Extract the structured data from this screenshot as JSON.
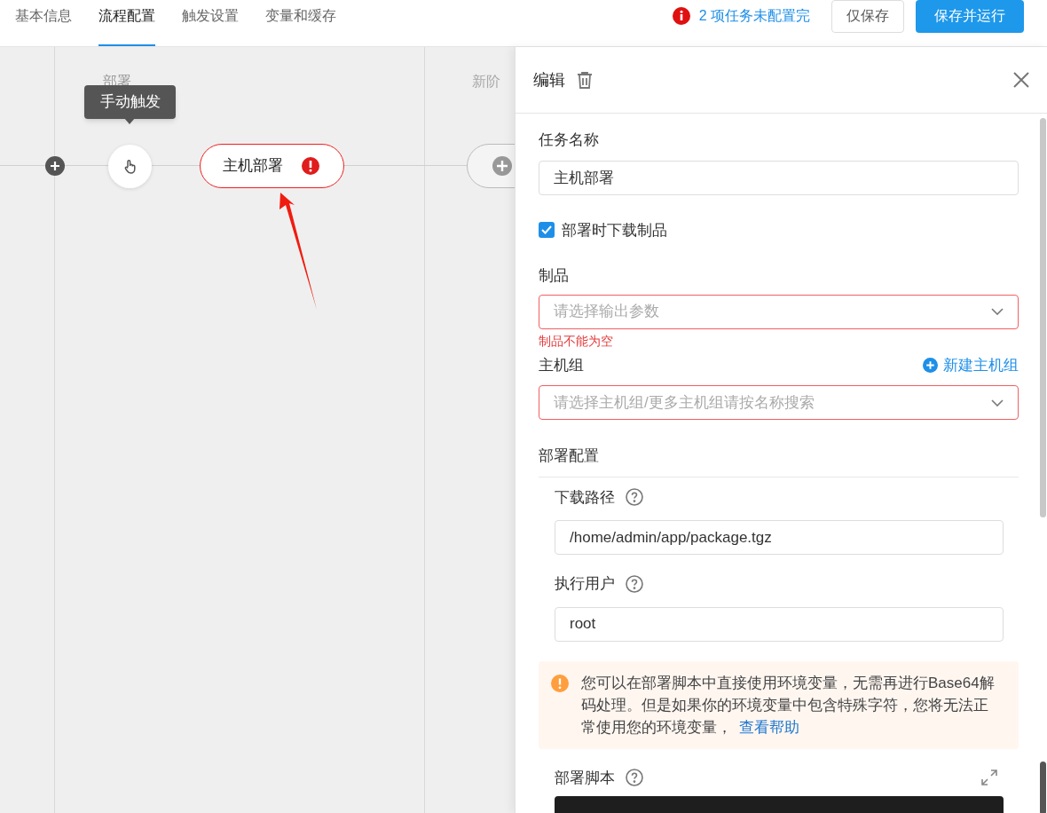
{
  "tabs": [
    {
      "label": "基本信息",
      "selected": false
    },
    {
      "label": "流程配置",
      "selected": true
    },
    {
      "label": "触发设置",
      "selected": false
    },
    {
      "label": "变量和缓存",
      "selected": false
    }
  ],
  "toolbar": {
    "warning": "2 项任务未配置完",
    "buttons": [
      {
        "label": "仅保存",
        "kind": "secondary"
      },
      {
        "label": "保存并运行",
        "kind": "primary"
      }
    ]
  },
  "canvas": {
    "stages": [
      {
        "title": "部署"
      },
      {
        "title": "新阶"
      }
    ],
    "tooltip": "手动触发",
    "task": {
      "label": "主机部署",
      "error": true
    }
  },
  "panel": {
    "title": "编辑",
    "task_name": {
      "label": "任务名称",
      "value": "主机部署"
    },
    "download_artifact": {
      "label": "部署时下载制品",
      "checked": true
    },
    "artifact": {
      "label": "制品",
      "placeholder": "请选择输出参数",
      "invalid": true,
      "error": "制品不能为空"
    },
    "host_group": {
      "label": "主机组",
      "action": "新建主机组",
      "placeholder": "请选择主机组/更多主机组请按名称搜索",
      "invalid": true
    },
    "deploy_config": {
      "title": "部署配置",
      "fields": [
        {
          "label": "下载路径",
          "value": "/home/admin/app/package.tgz"
        },
        {
          "label": "执行用户",
          "value": "root"
        }
      ],
      "notice": {
        "text": "您可以在部署脚本中直接使用环境变量，无需再进行Base64解码处理。但是如果你的环境变量中包含特殊字符，您将无法正常使用您的环境变量，",
        "link": "查看帮助"
      },
      "script": {
        "label": "部署脚本"
      }
    }
  }
}
